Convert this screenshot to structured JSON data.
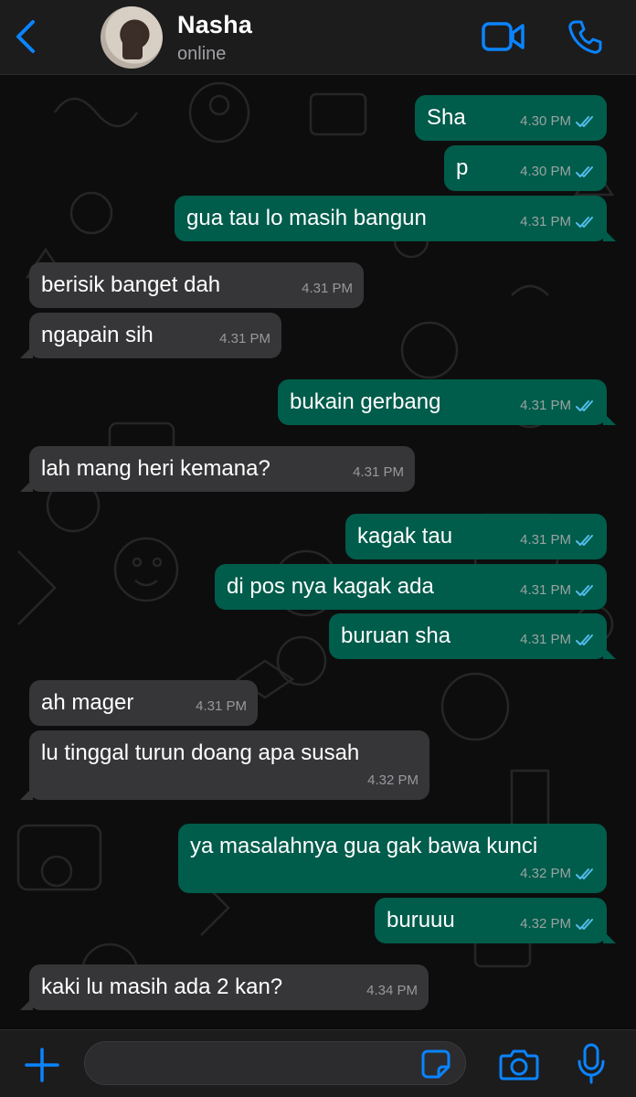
{
  "header": {
    "back_icon": "chevron-left-icon",
    "contact_name": "Nasha",
    "status": "online",
    "video_icon": "video-camera-icon",
    "call_icon": "phone-icon",
    "accent_color": "#0a84ff"
  },
  "messages": [
    {
      "dir": "out",
      "text": "Sha",
      "time": "4.30 PM",
      "read": true
    },
    {
      "dir": "out",
      "text": "p",
      "time": "4.30 PM",
      "read": true
    },
    {
      "dir": "out",
      "text": "gua tau lo masih bangun",
      "time": "4.31 PM",
      "read": true
    },
    {
      "dir": "in",
      "text": "berisik banget dah",
      "time": "4.31 PM"
    },
    {
      "dir": "in",
      "text": "ngapain sih",
      "time": "4.31 PM"
    },
    {
      "dir": "out",
      "text": "bukain gerbang",
      "time": "4.31 PM",
      "read": true
    },
    {
      "dir": "in",
      "text": "lah mang heri kemana?",
      "time": "4.31 PM"
    },
    {
      "dir": "out",
      "text": "kagak tau",
      "time": "4.31 PM",
      "read": true
    },
    {
      "dir": "out",
      "text": "di pos nya kagak ada",
      "time": "4.31 PM",
      "read": true
    },
    {
      "dir": "out",
      "text": "buruan sha",
      "time": "4.31 PM",
      "read": true
    },
    {
      "dir": "in",
      "text": "ah mager",
      "time": "4.31 PM"
    },
    {
      "dir": "in",
      "text": "lu tinggal turun doang apa susah",
      "time": "4.32 PM"
    },
    {
      "dir": "out",
      "text": "ya masalahnya gua gak bawa kunci",
      "time": "4.32 PM",
      "read": true
    },
    {
      "dir": "out",
      "text": "buruuu",
      "time": "4.32 PM",
      "read": true
    },
    {
      "dir": "in",
      "text": "kaki lu masih ada 2 kan?",
      "time": "4.34 PM"
    }
  ],
  "composer": {
    "placeholder": "",
    "plus_icon": "plus-icon",
    "sticker_icon": "sticker-icon",
    "camera_icon": "camera-icon",
    "mic_icon": "microphone-icon"
  },
  "colors": {
    "outgoing_bubble": "#005c4b",
    "incoming_bubble": "#363638",
    "read_ticks": "#53bdeb"
  }
}
